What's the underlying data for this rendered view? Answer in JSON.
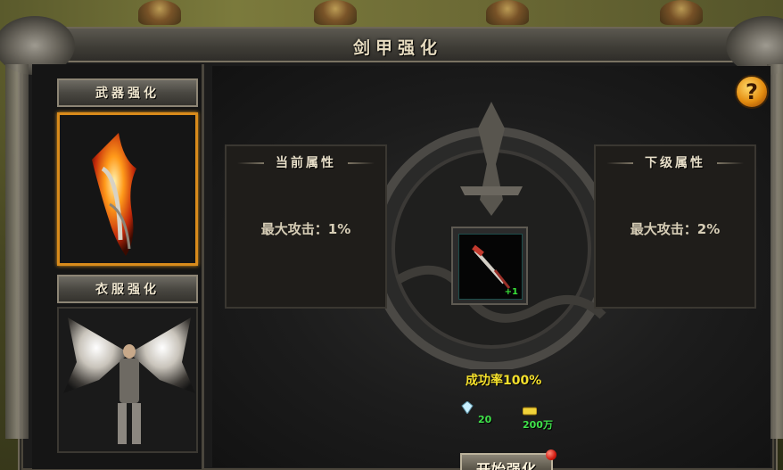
{
  "window": {
    "title": "剑甲强化"
  },
  "categories": [
    {
      "label": "武器强化",
      "selected": true,
      "image": "flame-sword"
    },
    {
      "label": "衣服强化",
      "selected": false,
      "image": "winged-armor"
    }
  ],
  "current": {
    "title": "当前属性",
    "stat": "最大攻击：1%"
  },
  "next": {
    "title": "下级属性",
    "stat": "最大攻击：2%"
  },
  "item_slot": {
    "level_badge": "+1",
    "icon": "sword-item-icon"
  },
  "success_rate": "成功率100%",
  "costs": [
    {
      "icon": "gem-icon",
      "amount": "20"
    },
    {
      "icon": "gold-icon",
      "amount": "200万"
    }
  ],
  "start_button": {
    "label": "开始强化",
    "has_notification": true
  },
  "help_button": {
    "label": "?"
  },
  "colors": {
    "selected_border": "#d98b1b",
    "success_rate": "#f5e12c",
    "cost_text": "#3fe14a",
    "plus_badge": "#39e339"
  }
}
